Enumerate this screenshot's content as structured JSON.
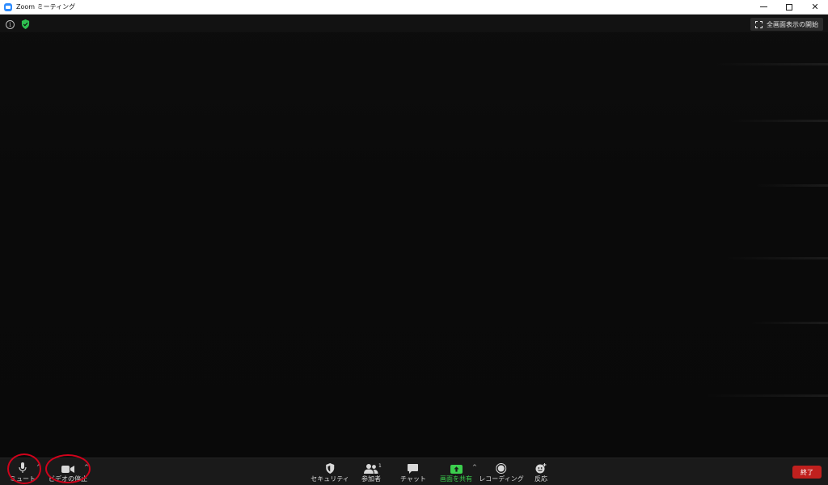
{
  "window": {
    "title": "Zoom ミーティング",
    "minimize_icon": "minimize-icon",
    "maximize_icon": "maximize-icon",
    "close_icon": "close-icon",
    "close_glyph": "✕"
  },
  "meeting": {
    "info_glyph": "i",
    "fullscreen_label": "全画面表示の開始"
  },
  "toolbar": {
    "mute_label": "ミュート",
    "video_label": "ビデオの停止",
    "security_label": "セキュリティ",
    "participants_label": "参加者",
    "participants_count": "1",
    "chat_label": "チャット",
    "share_label": "画面を共有",
    "record_label": "レコーディング",
    "reactions_label": "反応",
    "end_label": "終了",
    "caret_glyph": "^"
  },
  "colors": {
    "share_green": "#3ccf4e",
    "end_red": "#c0201e",
    "highlight_ring": "#d0021b",
    "shield_green": "#2dbf4f"
  }
}
